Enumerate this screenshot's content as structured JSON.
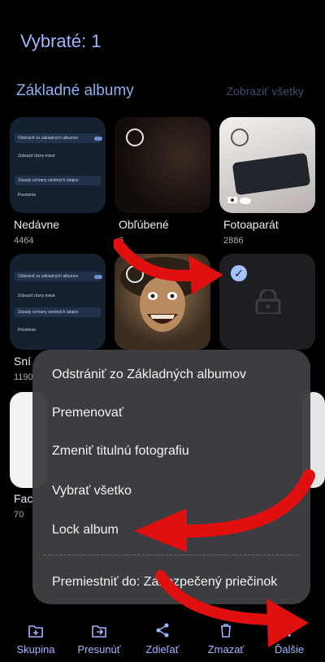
{
  "header": {
    "title": "Vybraté: 1"
  },
  "section": {
    "title": "Základné albumy",
    "see_all": "Zobraziť všetky"
  },
  "albums": [
    {
      "label": "Nedávne",
      "count": "4464"
    },
    {
      "label": "Obľúbené",
      "count": "6"
    },
    {
      "label": "Fotoaparát",
      "count": "2886"
    },
    {
      "label": "Sní",
      "count": "1190"
    },
    {
      "label": "Fac",
      "count": "70"
    }
  ],
  "thumb_settings": {
    "rows": [
      "Odstrániť zo základných albumov",
      "Zobraziť rôzny miest",
      "Zásady ochrany osobných údajov",
      "Povolenia"
    ]
  },
  "menu": {
    "items": [
      "Odstrániť zo Základných albumov",
      "Premenovať",
      "Zmeniť titulnú fotografiu",
      "Vybrať všetko",
      "Lock album",
      "Premiestniť do: Zabezpečený priečinok"
    ]
  },
  "bottom_bar": {
    "items": [
      {
        "label": "Skupina",
        "icon": "group-add-icon"
      },
      {
        "label": "Presunúť",
        "icon": "move-icon"
      },
      {
        "label": "Zdieľať",
        "icon": "share-icon"
      },
      {
        "label": "Zmazať",
        "icon": "delete-icon"
      },
      {
        "label": "Ďalšie",
        "icon": "more-vertical-icon"
      }
    ]
  },
  "colors": {
    "accent": "#9fb7ff",
    "arrow": "#e01010",
    "menu_bg": "#3e3f42"
  }
}
